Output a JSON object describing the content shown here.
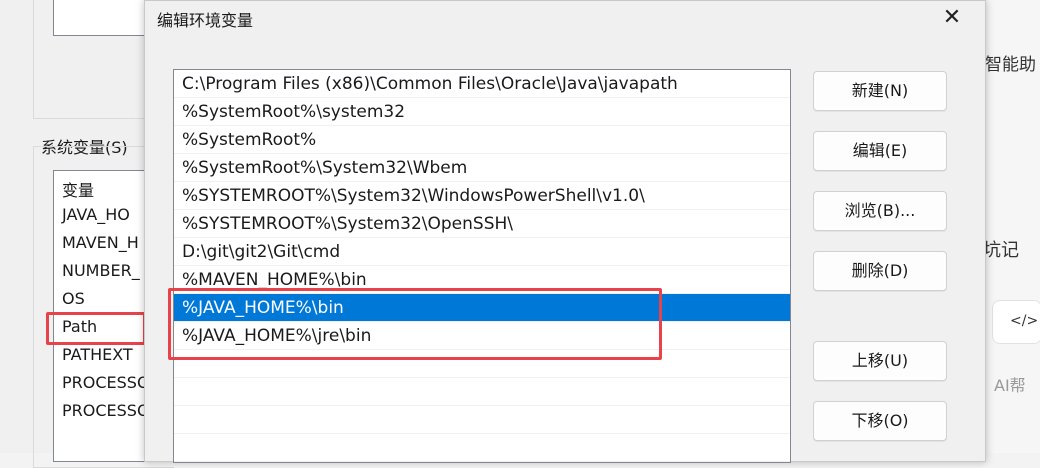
{
  "background_window": {
    "system_vars_label": "系统变量(S)",
    "list_header": "变量",
    "rows": [
      "JAVA_HO",
      "MAVEN_H",
      "NUMBER_",
      "OS",
      "Path",
      "PATHEXT",
      "PROCESSO",
      "PROCESSO"
    ]
  },
  "background_page": {
    "text_top": "智能助",
    "text_mid": "坑记",
    "code_icon_text": "</>",
    "text_bottom": "，AI帮"
  },
  "dialog": {
    "title": "编辑环境变量",
    "close_glyph": "✕",
    "entries": [
      "C:\\Program Files (x86)\\Common Files\\Oracle\\Java\\javapath",
      "%SystemRoot%\\system32",
      "%SystemRoot%",
      "%SystemRoot%\\System32\\Wbem",
      "%SYSTEMROOT%\\System32\\WindowsPowerShell\\v1.0\\",
      "%SYSTEMROOT%\\System32\\OpenSSH\\",
      "D:\\git\\git2\\Git\\cmd",
      "%MAVEN_HOME%\\bin",
      "%JAVA_HOME%\\bin",
      "%JAVA_HOME%\\jre\\bin"
    ],
    "selected_entry": "%JAVA_HOME%\\bin",
    "buttons": {
      "new": "新建(N)",
      "edit": "编辑(E)",
      "browse": "浏览(B)...",
      "delete": "删除(D)",
      "move_up": "上移(U)",
      "move_down": "下移(O)"
    }
  },
  "colors": {
    "selection": "#0078d7",
    "highlight_box": "#e8434a"
  }
}
